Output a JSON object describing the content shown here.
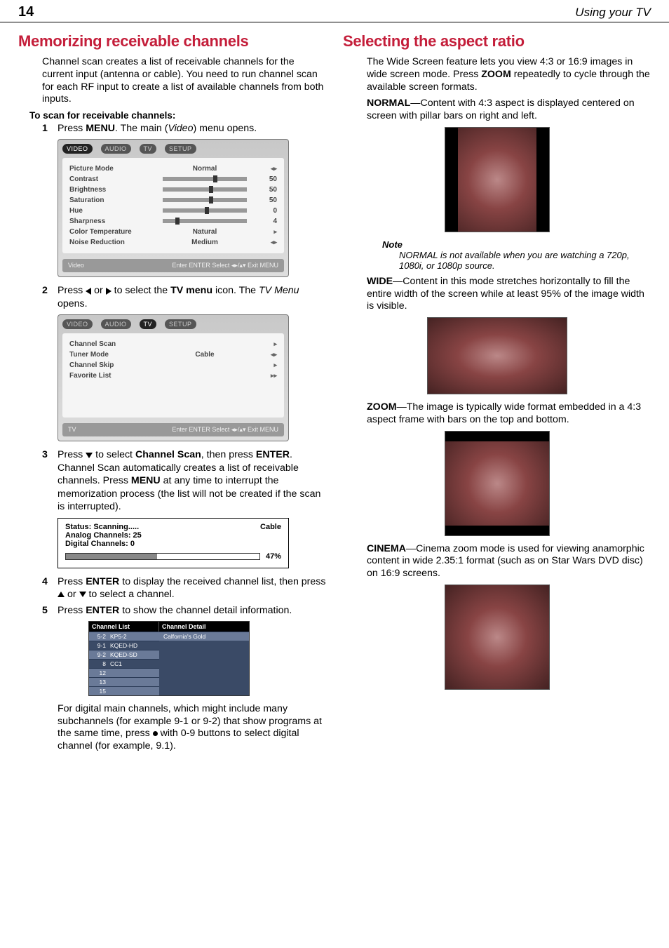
{
  "page": {
    "number": "14",
    "running_head": "Using your TV"
  },
  "left": {
    "heading": "Memorizing receivable channels",
    "intro": "Channel scan creates a list of receivable channels for the current input (antenna or cable). You need to run channel scan for each RF input to create a list of available channels from both inputs.",
    "scan_heading": "To scan for receivable channels:",
    "steps": {
      "s1_num": "1",
      "s1_a": "Press ",
      "s1_menu": "MENU",
      "s1_b": ". The main (",
      "s1_video": "Video",
      "s1_c": ") menu opens.",
      "s2_num": "2",
      "s2_a": "Press ",
      "s2_b": " or ",
      "s2_c": " to select the ",
      "s2_tvmenu": "TV menu",
      "s2_d": " icon. The ",
      "s2_tvmenu_it": "TV Menu",
      "s2_e": " opens.",
      "s3_num": "3",
      "s3_a": "Press ",
      "s3_b": " to select ",
      "s3_chscan": "Channel Scan",
      "s3_c": ", then press ",
      "s3_enter": "ENTER",
      "s3_d": ".",
      "s3_body_a": "Channel Scan automatically creates a list of receivable channels. Press ",
      "s3_body_menu": "MENU",
      "s3_body_b": " at any time to interrupt the memorization process (the list will not be created if the scan is interrupted).",
      "s4_num": "4",
      "s4_a": "Press ",
      "s4_enter": "ENTER",
      "s4_b": " to display the received channel list, then press ",
      "s4_c": " or ",
      "s4_d": " to select a channel.",
      "s5_num": "5",
      "s5_a": "Press ",
      "s5_enter": "ENTER",
      "s5_b": " to show the channel detail information.",
      "tail_a": "For digital main channels, which might include many subchannels (for example 9-1 or 9-2) that show programs at the same time, press ",
      "tail_b": " with 0-9 buttons to select digital channel (for example, 9.1)."
    },
    "menu1": {
      "tabs": [
        "VIDEO",
        "AUDIO",
        "TV",
        "SETUP"
      ],
      "rows": [
        {
          "label": "Picture Mode",
          "mid": "Normal",
          "val": ""
        },
        {
          "label": "Contrast",
          "mid": "slider",
          "val": "50",
          "pos": "60%"
        },
        {
          "label": "Brightness",
          "mid": "slider",
          "val": "50",
          "pos": "55%"
        },
        {
          "label": "Saturation",
          "mid": "slider",
          "val": "50",
          "pos": "55%"
        },
        {
          "label": "Hue",
          "mid": "slider",
          "val": "0",
          "pos": "50%"
        },
        {
          "label": "Sharpness",
          "mid": "slider",
          "val": "4",
          "pos": "15%"
        },
        {
          "label": "Color Temperature",
          "mid": "Natural",
          "val": ""
        },
        {
          "label": "Noise Reduction",
          "mid": "Medium",
          "val": ""
        }
      ],
      "footer_left": "Video",
      "footer_right": "Enter ENTER  Select ◂▸/▴▾  Exit MENU"
    },
    "menu2": {
      "tabs": [
        "VIDEO",
        "AUDIO",
        "TV",
        "SETUP"
      ],
      "rows": [
        {
          "label": "Channel Scan",
          "mid": "",
          "val": ""
        },
        {
          "label": "Tuner Mode",
          "mid": "Cable",
          "val": ""
        },
        {
          "label": "Channel Skip",
          "mid": "",
          "val": ""
        },
        {
          "label": "Favorite List",
          "mid": "",
          "val": ""
        }
      ],
      "footer_left": "TV",
      "footer_right": "Enter ENTER  Select ◂▸/▴▾  Exit MENU"
    },
    "scan": {
      "status": "Status: Scanning.....",
      "mode": "Cable",
      "analog": "Analog Channels: 25",
      "digital": "Digital Channels: 0",
      "pct": "47%"
    },
    "chlist": {
      "head_l": "Channel List",
      "head_r": "Channel Detail",
      "rows": [
        {
          "n": "5-2",
          "t": "KP5-2"
        },
        {
          "n": "9-1",
          "t": "KQED-HD"
        },
        {
          "n": "9-2",
          "t": "KQED-SD"
        },
        {
          "n": "8",
          "t": "CC1"
        },
        {
          "n": "12",
          "t": ""
        },
        {
          "n": "13",
          "t": ""
        },
        {
          "n": "15",
          "t": ""
        }
      ],
      "detail": "Calfornia's Gold"
    }
  },
  "right": {
    "heading": "Selecting the aspect ratio",
    "intro_a": "The Wide Screen feature lets you view 4:3 or 16:9 images in wide screen mode. Press ",
    "intro_zoom": "ZOOM",
    "intro_b": " repeatedly to cycle through the available screen formats.",
    "normal_label": "NORMAL",
    "normal_text": "—Content with 4:3 aspect is displayed centered on screen with pillar bars on right and left.",
    "note_title": "Note",
    "note_body": "NORMAL is not available when you are watching a 720p, 1080i, or 1080p source.",
    "wide_label": "WIDE",
    "wide_text": "—Content in this mode stretches horizontally to fill the entire width of the screen while at least 95% of the image width is visible.",
    "zoom_label": "ZOOM",
    "zoom_text": "—The image is typically wide format embedded in a 4:3 aspect frame with bars on the top and bottom.",
    "cinema_label": "CINEMA",
    "cinema_text": "—Cinema zoom mode is used for viewing anamorphic content in wide 2.35:1 format (such as on Star Wars DVD disc) on 16:9 screens."
  }
}
